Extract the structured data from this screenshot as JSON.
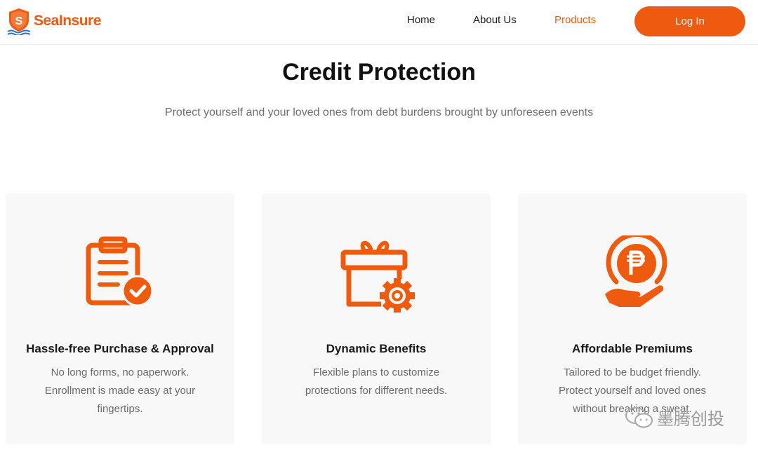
{
  "brand": {
    "name": "SeaInsure",
    "logo_letter": "S"
  },
  "nav": {
    "items": [
      {
        "label": "Home",
        "active": false
      },
      {
        "label": "About Us",
        "active": false
      },
      {
        "label": "Products",
        "active": true
      }
    ],
    "login_label": "Log In"
  },
  "hero": {
    "title": "Credit Protection",
    "subtitle": "Protect yourself and your loved ones from debt burdens brought by unforeseen events"
  },
  "features": [
    {
      "icon": "clipboard-check-icon",
      "title": "Hassle-free Purchase & Approval",
      "lines": [
        "No long forms, no paperwork.",
        "Enrollment is made easy at your",
        "fingertips."
      ]
    },
    {
      "icon": "gift-gear-icon",
      "title": "Dynamic Benefits",
      "lines": [
        "Flexible plans to customize",
        "protections for different needs."
      ]
    },
    {
      "icon": "peso-hand-icon",
      "title": "Affordable Premiums",
      "lines": [
        "Tailored to be budget friendly.",
        "Protect yourself and loved ones",
        "without breaking a sweat."
      ]
    }
  ],
  "watermark": {
    "text": "墨腾创投"
  },
  "colors": {
    "accent": "#ee5a0e",
    "card_bg": "#f8f8f8",
    "text_muted": "#6e6e6e"
  }
}
